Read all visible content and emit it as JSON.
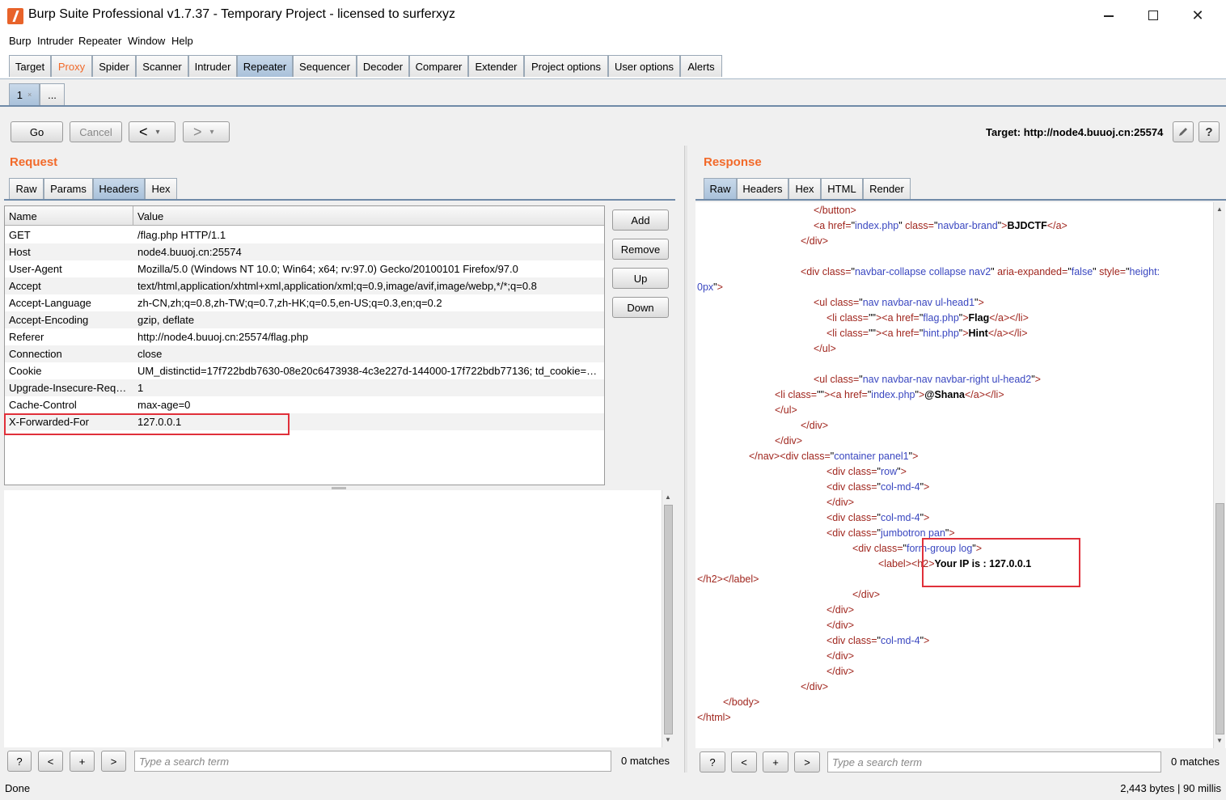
{
  "window": {
    "title": "Burp Suite Professional v1.7.37 - Temporary Project - licensed to surferxyz"
  },
  "menu": [
    "Burp",
    "Intruder",
    "Repeater",
    "Window",
    "Help"
  ],
  "main_tabs": [
    "Target",
    "Proxy",
    "Spider",
    "Scanner",
    "Intruder",
    "Repeater",
    "Sequencer",
    "Decoder",
    "Comparer",
    "Extender",
    "Project options",
    "User options",
    "Alerts"
  ],
  "sub_tabs": [
    {
      "label": "1",
      "close": "×"
    },
    {
      "label": "..."
    }
  ],
  "toolbar": {
    "go": "Go",
    "cancel": "Cancel",
    "back": "<",
    "forward": ">",
    "dropdown": "▾",
    "target": "Target: http://node4.buuoj.cn:25574"
  },
  "request": {
    "title": "Request",
    "tabs": [
      "Raw",
      "Params",
      "Headers",
      "Hex"
    ],
    "table_headers": {
      "name": "Name",
      "value": "Value"
    },
    "rows": [
      {
        "name": "GET",
        "value": "/flag.php HTTP/1.1"
      },
      {
        "name": "Host",
        "value": "node4.buuoj.cn:25574"
      },
      {
        "name": "User-Agent",
        "value": "Mozilla/5.0 (Windows NT 10.0; Win64; x64; rv:97.0) Gecko/20100101 Firefox/97.0"
      },
      {
        "name": "Accept",
        "value": "text/html,application/xhtml+xml,application/xml;q=0.9,image/avif,image/webp,*/*;q=0.8"
      },
      {
        "name": "Accept-Language",
        "value": "zh-CN,zh;q=0.8,zh-TW;q=0.7,zh-HK;q=0.5,en-US;q=0.3,en;q=0.2"
      },
      {
        "name": "Accept-Encoding",
        "value": "gzip, deflate"
      },
      {
        "name": "Referer",
        "value": "http://node4.buuoj.cn:25574/flag.php"
      },
      {
        "name": "Connection",
        "value": "close"
      },
      {
        "name": "Cookie",
        "value": "UM_distinctid=17f722bdb7630-08e20c6473938-4c3e227d-144000-17f722bdb77136; td_cookie=20..."
      },
      {
        "name": "Upgrade-Insecure-Requ...",
        "value": "1"
      },
      {
        "name": "Cache-Control",
        "value": "max-age=0"
      },
      {
        "name": "X-Forwarded-For",
        "value": "127.0.0.1"
      }
    ],
    "side_buttons": [
      "Add",
      "Remove",
      "Up",
      "Down"
    ],
    "search": {
      "help": "?",
      "prev": "<",
      "plus": "+",
      "next": ">",
      "placeholder": "Type a search term",
      "matches": "0 matches"
    }
  },
  "response": {
    "title": "Response",
    "tabs": [
      "Raw",
      "Headers",
      "Hex",
      "HTML",
      "Render"
    ],
    "search": {
      "help": "?",
      "prev": "<",
      "plus": "+",
      "next": ">",
      "placeholder": "Type a search term",
      "matches": "0 matches"
    }
  },
  "status": {
    "left": "Done",
    "right": "2,443 bytes | 90 millis"
  },
  "colors": {
    "accent": "#f26a2a",
    "highlight_box": "#e0303a"
  }
}
